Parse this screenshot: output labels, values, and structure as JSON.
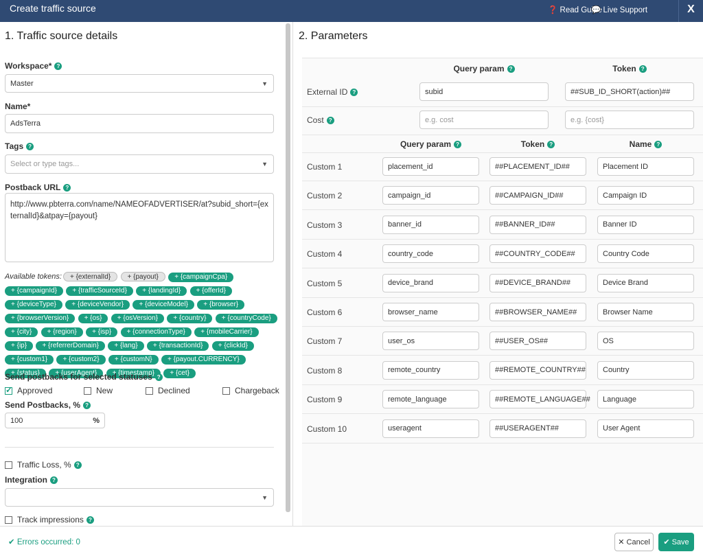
{
  "header": {
    "title": "Create traffic source",
    "read_guide": "Read Guide",
    "live_support": "Live Support",
    "close": "X"
  },
  "left": {
    "title": "1. Traffic source details",
    "workspace": {
      "label": "Workspace*",
      "value": "Master"
    },
    "name": {
      "label": "Name*",
      "value": "AdsTerra"
    },
    "tags": {
      "label": "Tags",
      "placeholder": "Select or type tags..."
    },
    "postback": {
      "label": "Postback URL",
      "value": "http://www.pbterra.com/name/NAMEOFADVERTISER/at?subid_short={externalId}&atpay={payout}"
    },
    "tokens_label": "Available tokens:",
    "tokens_used": [
      "+ {externalId}",
      "+ {payout}"
    ],
    "tokens": [
      "+ {campaignCpa}",
      "+ {campaignId}",
      "+ {trafficSourceId}",
      "+ {landingId}",
      "+ {offerId}",
      "+ {deviceType}",
      "+ {deviceVendor}",
      "+ {deviceModel}",
      "+ {browser}",
      "+ {browserVersion}",
      "+ {os}",
      "+ {osVersion}",
      "+ {country}",
      "+ {countryCode}",
      "+ {city}",
      "+ {region}",
      "+ {isp}",
      "+ {connectionType}",
      "+ {mobileCarrier}",
      "+ {ip}",
      "+ {referrerDomain}",
      "+ {lang}",
      "+ {transactionId}",
      "+ {clickId}",
      "+ {custom1}",
      "+ {custom2}",
      "+ {customN}",
      "+ {payout.CURRENCY}",
      "+ {status}",
      "+ {userAgent}",
      "+ {timestamp}",
      "+ {cet}"
    ],
    "statuses_label": "Send postbacks for selected statuses",
    "statuses": [
      {
        "label": "Approved",
        "checked": true
      },
      {
        "label": "New",
        "checked": false
      },
      {
        "label": "Declined",
        "checked": false
      },
      {
        "label": "Chargeback",
        "checked": false
      }
    ],
    "send_pct": {
      "label": "Send Postbacks, %",
      "value": "100",
      "unit": "%"
    },
    "traffic_loss": {
      "label": "Traffic Loss, %",
      "checked": false
    },
    "integration": {
      "label": "Integration",
      "value": ""
    },
    "track_impressions": {
      "label": "Track impressions",
      "checked": false
    }
  },
  "right": {
    "title": "2. Parameters",
    "top_headers": {
      "query": "Query param",
      "token": "Token"
    },
    "top_rows": [
      {
        "label": "External ID",
        "query": "subid",
        "token": "##SUB_ID_SHORT(action)##",
        "help": true
      },
      {
        "label": "Cost",
        "query_ph": "e.g. cost",
        "token_ph": "e.g. {cost}",
        "help": true
      }
    ],
    "headers": {
      "query": "Query param",
      "token": "Token",
      "name": "Name"
    },
    "customs": [
      {
        "label": "Custom 1",
        "query": "placement_id",
        "token": "##PLACEMENT_ID##",
        "name": "Placement ID"
      },
      {
        "label": "Custom 2",
        "query": "campaign_id",
        "token": "##CAMPAIGN_ID##",
        "name": "Campaign ID"
      },
      {
        "label": "Custom 3",
        "query": "banner_id",
        "token": "##BANNER_ID##",
        "name": "Banner ID"
      },
      {
        "label": "Custom 4",
        "query": "country_code",
        "token": "##COUNTRY_CODE##",
        "name": "Country Code"
      },
      {
        "label": "Custom 5",
        "query": "device_brand",
        "token": "##DEVICE_BRAND##",
        "name": "Device Brand"
      },
      {
        "label": "Custom 6",
        "query": "browser_name",
        "token": "##BROWSER_NAME##",
        "name": "Browser Name"
      },
      {
        "label": "Custom 7",
        "query": "user_os",
        "token": "##USER_OS##",
        "name": "OS"
      },
      {
        "label": "Custom 8",
        "query": "remote_country",
        "token": "##REMOTE_COUNTRY##",
        "name": "Country"
      },
      {
        "label": "Custom 9",
        "query": "remote_language",
        "token": "##REMOTE_LANGUAGE##",
        "name": "Language"
      },
      {
        "label": "Custom 10",
        "query": "useragent",
        "token": "##USERAGENT##",
        "name": "User Agent"
      }
    ]
  },
  "footer": {
    "errors": "Errors occurred: 0",
    "cancel": "Cancel",
    "save": "Save"
  },
  "colors": {
    "header": "#2f4a73",
    "accent": "#1a9e80"
  }
}
